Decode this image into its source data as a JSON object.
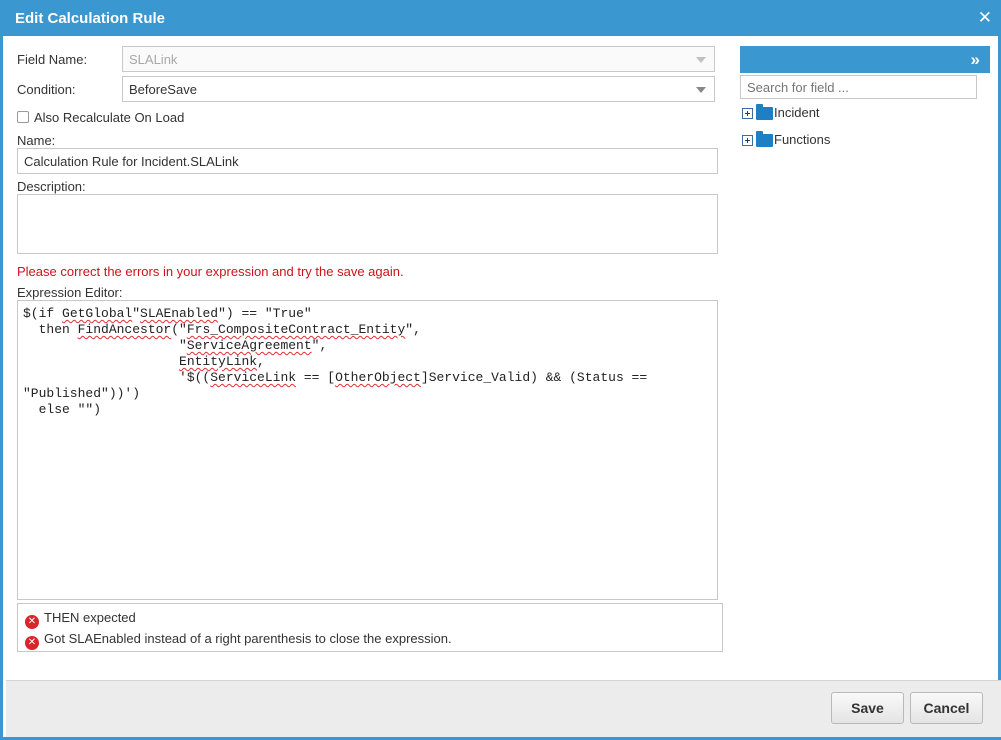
{
  "dialog": {
    "title": "Edit Calculation Rule",
    "close_glyph": "✕"
  },
  "form": {
    "field_name_label": "Field Name:",
    "field_name_value": "SLALink",
    "condition_label": "Condition:",
    "condition_value": "BeforeSave",
    "recalc_label": "Also Recalculate On Load",
    "recalc_checked": false,
    "name_label": "Name:",
    "name_value": "Calculation Rule for Incident.SLALink",
    "description_label": "Description:",
    "description_value": "",
    "error_message": "Please correct the errors in your expression and try the save again.",
    "editor_label": "Expression Editor:"
  },
  "editor": {
    "lines": [
      [
        {
          "t": "$(if "
        },
        {
          "t": "GetGlobal",
          "sq": true
        },
        {
          "t": "\""
        },
        {
          "t": "SLAEnabled",
          "sq": true
        },
        {
          "t": "\") == \"True\""
        }
      ],
      [
        {
          "t": "  then "
        },
        {
          "t": "FindAncestor",
          "sq": true
        },
        {
          "t": "(\""
        },
        {
          "t": "Frs_CompositeContract_Entity",
          "sq": true
        },
        {
          "t": "\","
        }
      ],
      [
        {
          "t": "                    \""
        },
        {
          "t": "ServiceAgreement",
          "sq": true
        },
        {
          "t": "\","
        }
      ],
      [
        {
          "t": "                    "
        },
        {
          "t": "EntityLink",
          "sq": true
        },
        {
          "t": ","
        }
      ],
      [
        {
          "t": "                    '$(("
        },
        {
          "t": "ServiceLink",
          "sq": true
        },
        {
          "t": " == ["
        },
        {
          "t": "OtherObject",
          "sq": true
        },
        {
          "t": "]Service_Valid) && (Status =="
        }
      ],
      [
        {
          "t": "\"Published\"))')"
        }
      ],
      [
        {
          "t": "  else \"\")"
        }
      ]
    ]
  },
  "errors": [
    "THEN expected",
    "Got SLAEnabled instead of a right parenthesis to close the expression."
  ],
  "right_panel": {
    "expand_glyph": "»",
    "search_placeholder": "Search for field ...",
    "tree": [
      {
        "label": "Incident"
      },
      {
        "label": "Functions"
      }
    ]
  },
  "footer": {
    "save_label": "Save",
    "cancel_label": "Cancel"
  },
  "colors": {
    "accent": "#3a97d0",
    "error": "#d0101d",
    "error_icon": "#d8262b",
    "folder": "#1d7fc4"
  },
  "icons": {
    "close": "close-icon",
    "expand": "double-chevron-right-icon",
    "error": "error-circle-icon",
    "folder": "folder-icon",
    "tree_expand": "plus-box-icon",
    "dropdown": "chevron-down-icon"
  }
}
